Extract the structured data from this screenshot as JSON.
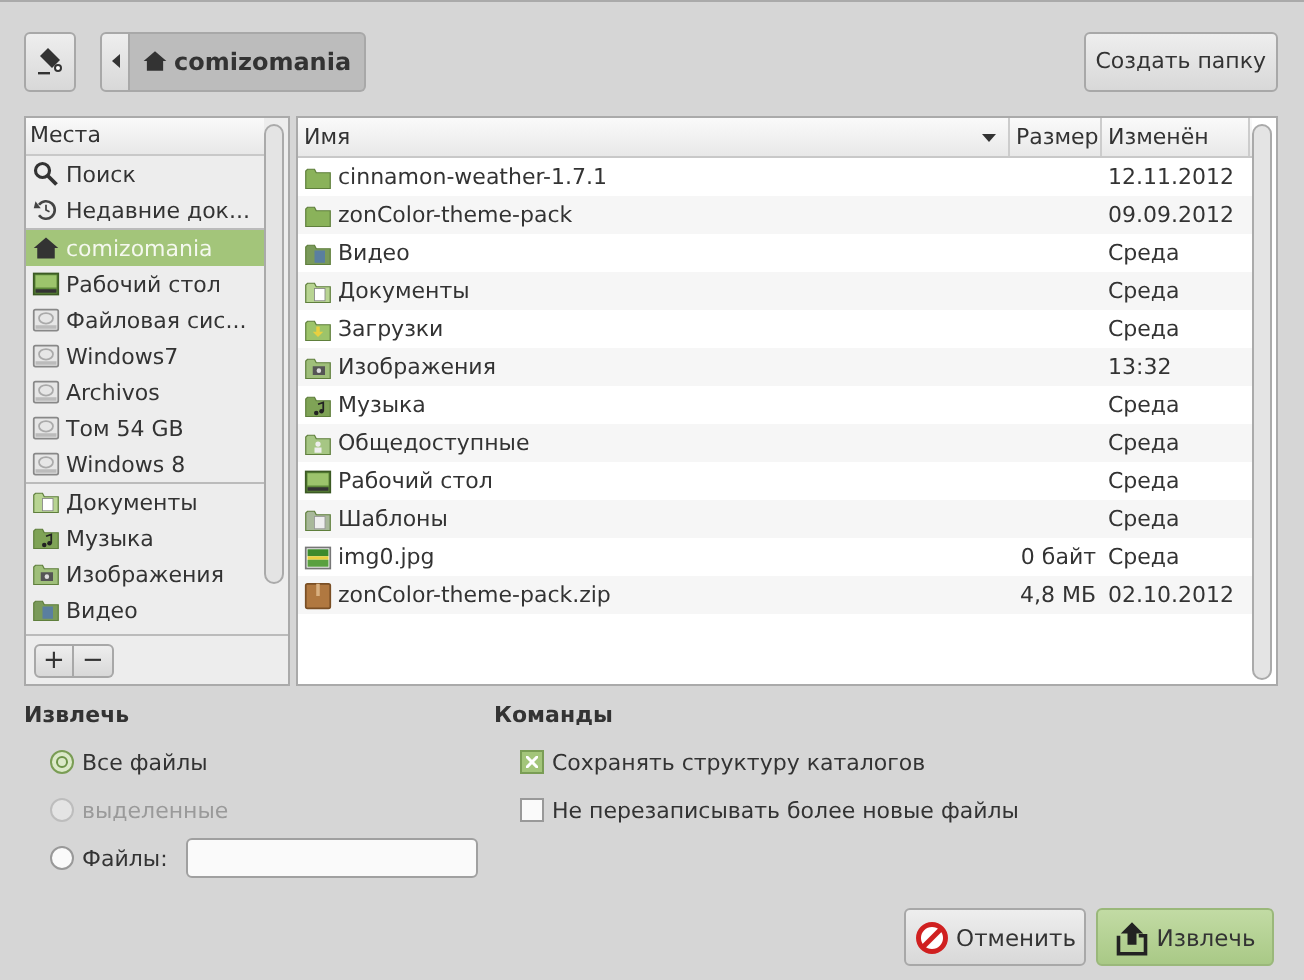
{
  "toolbar": {
    "path_button": {
      "label": "comizomania"
    },
    "create_folder": "Создать папку"
  },
  "places": {
    "header": "Места",
    "items": [
      {
        "label": "Поиск",
        "kind": "search",
        "selected": false,
        "separator_after": false
      },
      {
        "label": "Недавние док...",
        "kind": "recent",
        "selected": false,
        "separator_after": true
      },
      {
        "label": "comizomania",
        "kind": "home",
        "selected": true,
        "separator_after": false
      },
      {
        "label": "Рабочий стол",
        "kind": "desktop",
        "selected": false,
        "separator_after": false
      },
      {
        "label": "Файловая сис...",
        "kind": "drive",
        "selected": false,
        "separator_after": false
      },
      {
        "label": "Windows7",
        "kind": "drive",
        "selected": false,
        "separator_after": false
      },
      {
        "label": "Archivos",
        "kind": "drive",
        "selected": false,
        "separator_after": false
      },
      {
        "label": "Том 54 GB",
        "kind": "drive",
        "selected": false,
        "separator_after": false
      },
      {
        "label": "Windows 8",
        "kind": "drive",
        "selected": false,
        "separator_after": true
      },
      {
        "label": "Документы",
        "kind": "docs",
        "selected": false,
        "separator_after": false
      },
      {
        "label": "Музыка",
        "kind": "music",
        "selected": false,
        "separator_after": false
      },
      {
        "label": "Изображения",
        "kind": "images",
        "selected": false,
        "separator_after": false
      },
      {
        "label": "Видео",
        "kind": "video",
        "selected": false,
        "separator_after": false
      }
    ],
    "add": "+",
    "remove": "−"
  },
  "files": {
    "columns": [
      "Имя",
      "Размер",
      "Изменён"
    ],
    "rows": [
      {
        "name": "cinnamon-weather-1.7.1",
        "kind": "folder",
        "size": "",
        "modified": "12.11.2012"
      },
      {
        "name": "zonColor-theme-pack",
        "kind": "folder",
        "size": "",
        "modified": "09.09.2012"
      },
      {
        "name": "Видео",
        "kind": "video",
        "size": "",
        "modified": "Среда"
      },
      {
        "name": "Документы",
        "kind": "docs",
        "size": "",
        "modified": "Среда"
      },
      {
        "name": "Загрузки",
        "kind": "download",
        "size": "",
        "modified": "Среда"
      },
      {
        "name": "Изображения",
        "kind": "images",
        "size": "",
        "modified": "13:32"
      },
      {
        "name": "Музыка",
        "kind": "music",
        "size": "",
        "modified": "Среда"
      },
      {
        "name": "Общедоступные",
        "kind": "public",
        "size": "",
        "modified": "Среда"
      },
      {
        "name": "Рабочий стол",
        "kind": "desktop",
        "size": "",
        "modified": "Среда"
      },
      {
        "name": "Шаблоны",
        "kind": "templates",
        "size": "",
        "modified": "Среда"
      },
      {
        "name": "img0.jpg",
        "kind": "image-file",
        "size": "0 байт",
        "modified": "Среда"
      },
      {
        "name": "zonColor-theme-pack.zip",
        "kind": "archive",
        "size": "4,8 МБ",
        "modified": "02.10.2012"
      }
    ]
  },
  "extract": {
    "title": "Извлечь",
    "options": [
      {
        "label": "Все файлы",
        "kind": "radio",
        "selected": true,
        "disabled": false
      },
      {
        "label": "выделенные",
        "kind": "radio",
        "selected": false,
        "disabled": true
      },
      {
        "label": "Файлы:",
        "kind": "radio-field",
        "selected": false,
        "disabled": false
      }
    ]
  },
  "commands": {
    "title": "Команды",
    "options": [
      {
        "label": "Сохранять структуру каталогов",
        "checked": true
      },
      {
        "label": "Не перезаписывать более новые файлы",
        "checked": false
      }
    ]
  },
  "buttons": [
    {
      "label": "Отменить",
      "kind": "cancel",
      "suggested": false
    },
    {
      "label": "Извлечь",
      "kind": "extract",
      "suggested": true
    }
  ]
}
